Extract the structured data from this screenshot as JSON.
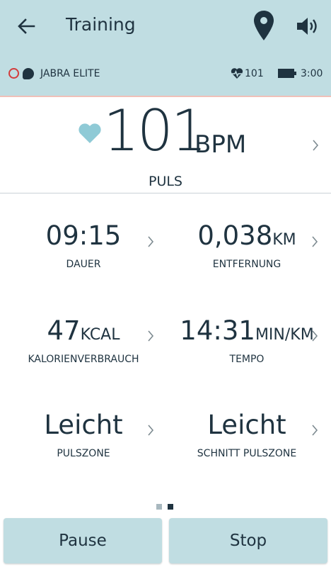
{
  "header": {
    "title": "Training",
    "icons": {
      "back": "arrow-left-icon",
      "location": "map-pin-icon",
      "volume": "speaker-icon"
    }
  },
  "status": {
    "device_name": "JABRA ELITE",
    "heart_rate": "101",
    "time": "3:00",
    "icons": [
      "ring-icon",
      "earbud-icon",
      "heart-rate-icon",
      "battery-icon"
    ]
  },
  "pulse": {
    "value": "101",
    "unit": "BPM",
    "label": "PULS"
  },
  "metrics": {
    "duration": {
      "value": "09:15",
      "unit": "",
      "label": "DAUER"
    },
    "distance": {
      "value": "0,038",
      "unit": "KM",
      "label": "ENTFERNUNG"
    },
    "calories": {
      "value": "47",
      "unit": "KCAL",
      "label": "KALORIENVERBRAUCH"
    },
    "pace": {
      "value": "14:31",
      "unit": "MIN/KM",
      "label": "TEMPO"
    },
    "pulse_zone": {
      "value": "Leicht",
      "unit": "",
      "label": "PULSZONE"
    },
    "avg_pulse_zone": {
      "value": "Leicht",
      "unit": "",
      "label": "SCHNITT PULSZONE"
    }
  },
  "pager": {
    "pages": 2,
    "active": 2
  },
  "buttons": {
    "pause": "Pause",
    "stop": "Stop"
  },
  "colors": {
    "header_bg": "#c0dde2",
    "text": "#1f3340",
    "heart": "#8fcad6",
    "ring": "#d33c3c"
  }
}
